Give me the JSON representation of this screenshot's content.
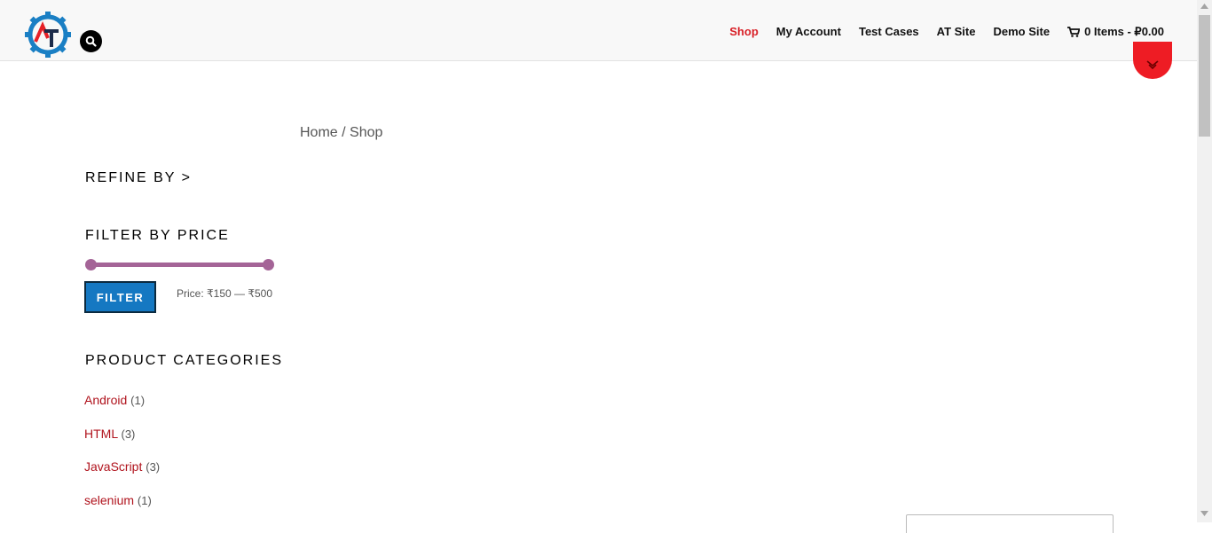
{
  "nav": {
    "items": [
      {
        "label": "Shop",
        "active": true
      },
      {
        "label": "My Account",
        "active": false
      },
      {
        "label": "Test Cases",
        "active": false
      },
      {
        "label": "AT Site",
        "active": false
      },
      {
        "label": "Demo Site",
        "active": false
      }
    ],
    "cart_label": "0 Items - ₽0.00"
  },
  "breadcrumb": {
    "home": "Home",
    "separator": " / ",
    "current": "Shop"
  },
  "sidebar": {
    "refine_title": "REFINE BY >",
    "price_filter": {
      "title": "FILTER BY PRICE",
      "button_label": "FILTER",
      "price_text": "Price: ₹150 — ₹500",
      "min_position": 0.0,
      "max_position": 1.0
    },
    "categories_title": "PRODUCT CATEGORIES",
    "categories": [
      {
        "name": "Android",
        "count": "(1)"
      },
      {
        "name": "HTML",
        "count": "(3)"
      },
      {
        "name": "JavaScript",
        "count": "(3)"
      },
      {
        "name": "selenium",
        "count": "(1)"
      }
    ]
  },
  "icons": {
    "logo": "automation-testing-gear-logo",
    "search": "search-icon",
    "cart": "cart-icon",
    "scroll": "chevron-down-icon"
  },
  "colors": {
    "accent_red": "#d81f26",
    "link_red": "#b0131d",
    "slider_purple": "#a46497",
    "button_blue": "#1578c2"
  }
}
